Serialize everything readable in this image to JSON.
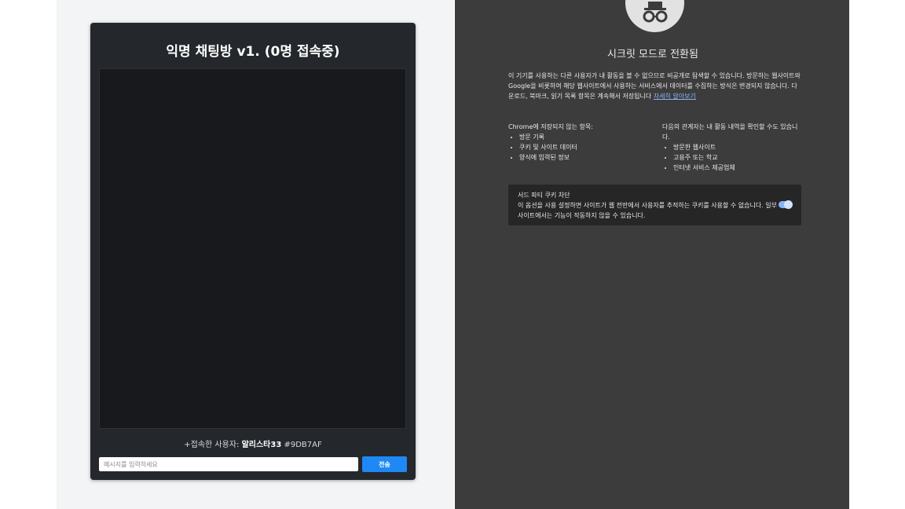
{
  "chat": {
    "title": "익명 채팅방 v1. (0명 접속중)",
    "status_prefix": "+접속한 사용자: ",
    "user_name": "알리스타33",
    "user_code": "#9DB7AF",
    "input_placeholder": "메시지를 입력하세요",
    "input_value": "",
    "send_label": "전송"
  },
  "incognito": {
    "icon": "incognito-icon",
    "heading": "시크릿 모드로 전환됨",
    "intro_text": "이 기기를 사용하는 다른 사용자가 내 활동을 볼 수 없으므로 비공개로 탐색할 수 있습니다. 방문하는 웹사이트와 Google을 비롯하여 해당 웹사이트에서 사용하는 서비스에서 데이터를 수집하는 방식은 변경되지 않습니다. 다운로드, 북마크, 읽기 목록 항목은 계속해서 저장됩니다",
    "learn_more": "자세히 알아보기",
    "not_saved_title": "Chrome에 저장되지 않는 항목:",
    "not_saved_items": [
      "방문 기록",
      "쿠키 및 사이트 데이터",
      "양식에 입력된 정보"
    ],
    "visible_title": "다음의 관계자는 내 활동 내역을 확인할 수도 있습니다.",
    "visible_items": [
      "방문한 웹사이트",
      "고용주 또는 학교",
      "인터넷 서비스 제공업체"
    ],
    "cookie_title": "서드 파티 쿠키 차단",
    "cookie_desc": "이 옵션을 사용 설정하면 사이트가 웹 전반에서 사용자를 추적하는 쿠키를 사용할 수 없습니다. 일부 사이트에서는 기능이 작동하지 않을 수 있습니다.",
    "cookie_toggle_on": true
  },
  "colors": {
    "chat_panel": "#24272c",
    "send_button": "#1e88f5",
    "incognito_bg": "#3c3c3c",
    "link": "#8ab4f8"
  }
}
